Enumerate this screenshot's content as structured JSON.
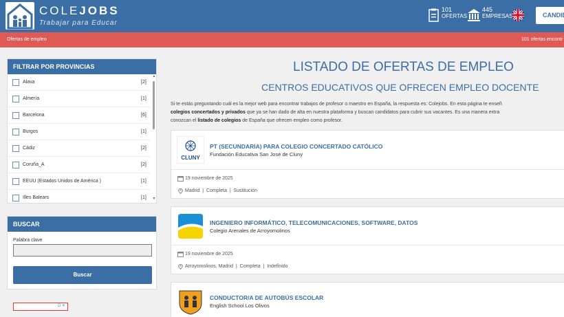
{
  "header": {
    "logo_text_light": "COLE",
    "logo_text_bold": "JOBS",
    "tagline": "Trabajar para Educar",
    "stats": [
      {
        "icon": "offers-icon",
        "number": "101",
        "label": "OFERTAS"
      },
      {
        "icon": "companies-icon",
        "number": "445",
        "label": "EMPRESAS"
      }
    ],
    "language_icon": "uk-flag-icon",
    "candidate_button": "CANDID"
  },
  "breadcrumb": {
    "left": "Ofertas de empleo",
    "right": "101 ofertas encontr"
  },
  "filter": {
    "title": "FILTRAR POR PROVINCIAS",
    "provinces": [
      {
        "name": "Alava",
        "count": "[2]"
      },
      {
        "name": "Almería",
        "count": "[1]"
      },
      {
        "name": "Barcelona",
        "count": "[6]"
      },
      {
        "name": "Burgos",
        "count": "[1]"
      },
      {
        "name": "Cádiz",
        "count": "[2]"
      },
      {
        "name": "Coruña_A",
        "count": "[2]"
      },
      {
        "name": "EEUU (Estados Unidos de América )",
        "count": "[1]"
      },
      {
        "name": "Illes Balears",
        "count": "[1]"
      }
    ]
  },
  "search": {
    "title": "BUSCAR",
    "keyword_label": "Palabra clave",
    "keyword_value": "",
    "button": "Buscar"
  },
  "ad": {
    "badge": "D ✕"
  },
  "main": {
    "title": "LISTADO DE OFERTAS DE EMPLEO",
    "subtitle": "CENTROS EDUCATIVOS QUE OFRECEN EMPLEO DOCENTE",
    "intro_1": "Si te estás preguntando cuál es la mejor web para encontrar trabajos de profesor o maestro en España, la respuesta es: Colejobs. En esta página te enseñ",
    "intro_2_bold": "colegios concertados y privados",
    "intro_2_rest": " que ya se han dado de alta en nuestra plataforma y buscan candidatos para cubrir sus vacantes. Es una manera extra",
    "intro_3_pre": "conozcan el ",
    "intro_3_bold": "listado de colegios",
    "intro_3_rest": " de España que ofrecen empleo como profesor."
  },
  "jobs": [
    {
      "title": "PT (SECUNDARIA) PARA COLEGIO CONCERTADO CATÓLICO",
      "company": "Fundación Educativa San José de Cluny",
      "logo_text": "CLUNY",
      "date": "19 noviembre de 2025",
      "location": "Madrid",
      "schedule": "Completa",
      "type": "Sustitución"
    },
    {
      "title": "INGENIERO INFORMÁTICO, TELECOMUNICACIONES, SOFTWARE, DATOS",
      "company": "Colegio Arenales de Arroyomolinos",
      "date": "19 noviembre de 2025",
      "location": "Arroyomolinos, Madrid",
      "schedule": "Completa",
      "type": "Indefinido"
    },
    {
      "title": "CONDUCTOR/A DE AUTOBÚS ESCOLAR",
      "company": "English School Los Olivos"
    }
  ],
  "colors": {
    "primary": "#3a6ea5",
    "accent_red": "#e05a55",
    "arenales_blue": "#1a8fd8",
    "arenales_yellow": "#f5d400",
    "olivos_orange": "#f0a020"
  }
}
